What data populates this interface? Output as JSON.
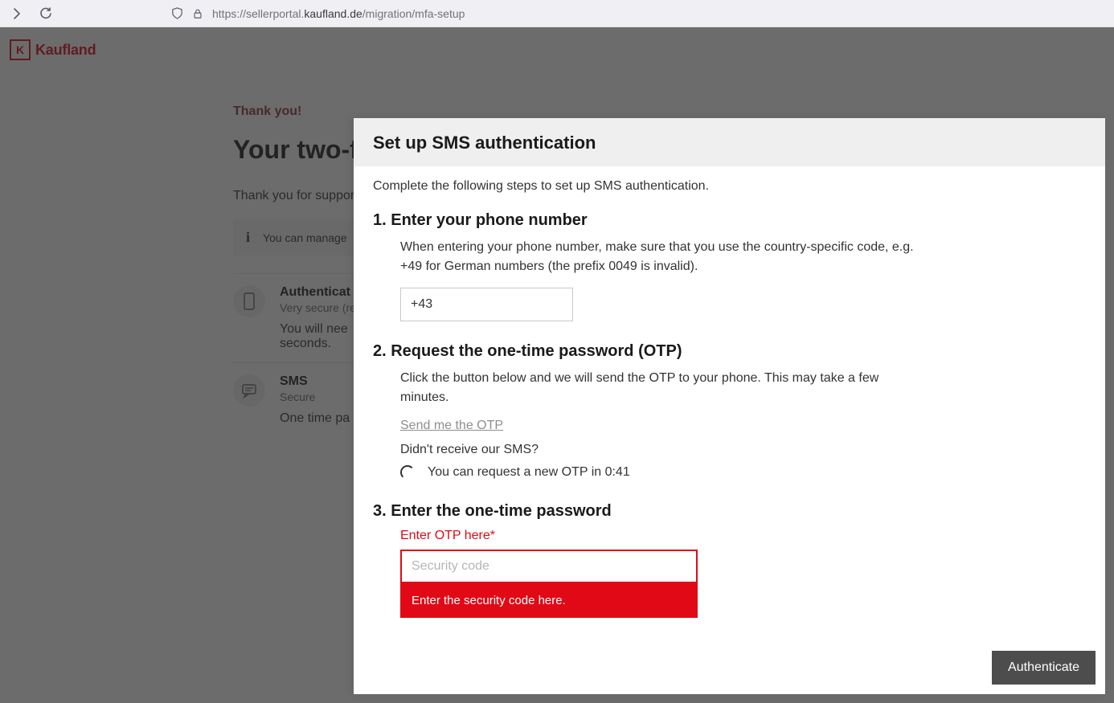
{
  "browser": {
    "url_prefix": "https://sellerportal.",
    "url_bold": "kaufland.de",
    "url_suffix": "/migration/mfa-setup"
  },
  "header": {
    "brand": "Kaufland"
  },
  "bg": {
    "thankyou": "Thank you!",
    "title": "Your two-fa",
    "support": "Thank you for suppor",
    "info": "You can manage",
    "auth_title": "Authenticat",
    "auth_sub": "Very secure (re",
    "auth_desc1": "You will nee",
    "auth_desc2": "seconds.",
    "sms_title": "SMS",
    "sms_sub": "Secure",
    "sms_desc": "One time pa"
  },
  "modal": {
    "title": "Set up SMS authentication",
    "intro": "Complete the following steps to set up SMS authentication.",
    "step1_h": "1. Enter your phone number",
    "step1_sub": "When entering your phone number, make sure that you use the country-specific code, e.g. +49 for German numbers (the prefix 0049 is invalid).",
    "phone_value": "+43",
    "step2_h": "2. Request the one-time password (OTP)",
    "step2_sub": "Click the button below and we will send the OTP to your phone. This may take a few minutes.",
    "send_link": "Send me the OTP",
    "didnt": "Didn't receive our SMS?",
    "timer": "You can request a new OTP in 0:41",
    "step3_h": "3. Enter the one-time password",
    "otp_label": "Enter OTP here*",
    "otp_placeholder": "Security code",
    "otp_error": "Enter the security code here.",
    "auth_btn": "Authenticate"
  }
}
